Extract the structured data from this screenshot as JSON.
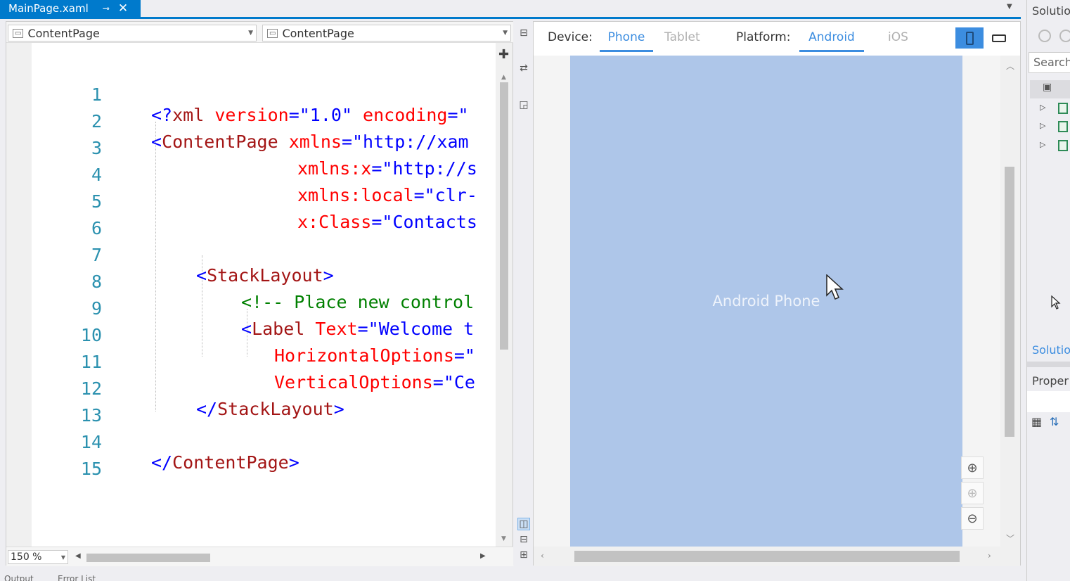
{
  "tab": {
    "title": "MainPage.xaml",
    "pin": "⊸",
    "close": "✕"
  },
  "navbar": {
    "left_combo": "ContentPage",
    "right_combo": "ContentPage"
  },
  "editor": {
    "zoom": "150 %",
    "lines": [
      {
        "n": "1"
      },
      {
        "n": "2"
      },
      {
        "n": "3"
      },
      {
        "n": "4"
      },
      {
        "n": "5"
      },
      {
        "n": "6"
      },
      {
        "n": "7"
      },
      {
        "n": "8"
      },
      {
        "n": "9"
      },
      {
        "n": "10"
      },
      {
        "n": "11"
      },
      {
        "n": "12"
      },
      {
        "n": "13"
      },
      {
        "n": "14"
      },
      {
        "n": "15"
      }
    ]
  },
  "code": {
    "l1_open": "<?",
    "l1_tag": "xml",
    "l1_a1": " version",
    "l1_v1": "=\"1.0\"",
    "l1_a2": " encoding",
    "l1_v2": "=\"",
    "l2_br": "<",
    "l2_tag": "ContentPage",
    "l2_a": " xmlns",
    "l2_v": "=\"http://xam",
    "l3_a": "xmlns:x",
    "l3_v": "=\"http://s",
    "l4_a": "xmlns:local",
    "l4_v": "=\"clr-",
    "l5_a": "x:Class",
    "l5_v": "=\"Contacts",
    "l7_br": "<",
    "l7_tag": "StackLayout",
    "l7_cl": ">",
    "l8_cmt": "<!-- Place new control",
    "l9_br": "<",
    "l9_tag": "Label",
    "l9_a": " Text",
    "l9_v": "=\"Welcome t",
    "l10_a": "HorizontalOptions",
    "l10_v": "=\"",
    "l11_a": "VerticalOptions",
    "l11_v": "=\"Ce",
    "l12_br": "</",
    "l12_tag": "StackLayout",
    "l12_cl": ">",
    "l14_br": "</",
    "l14_tag": "ContentPage",
    "l14_cl": ">"
  },
  "designer": {
    "device_label": "Device:",
    "device_options": [
      "Phone",
      "Tablet"
    ],
    "platform_label": "Platform:",
    "platform_options": [
      "Android",
      "iOS"
    ],
    "preview_text": "Android Phone"
  },
  "right_panel": {
    "solution_title": "Solutio",
    "search_placeholder": "Search",
    "solution_tab": "Solutio",
    "properties_title": "Proper"
  },
  "bottom": {
    "output": "Output",
    "error_list": "Error List"
  },
  "colors": {
    "accent": "#007acc",
    "designer_accent": "#3c8de0",
    "device_bg": "#aec6e9"
  },
  "icons": [
    "pin-icon",
    "close-icon",
    "content-page-icon",
    "plus-icon",
    "swap-icon",
    "zoom-in-icon",
    "zoom-fit-icon",
    "zoom-out-icon",
    "portrait-icon",
    "landscape-icon",
    "back-icon",
    "forward-icon"
  ]
}
